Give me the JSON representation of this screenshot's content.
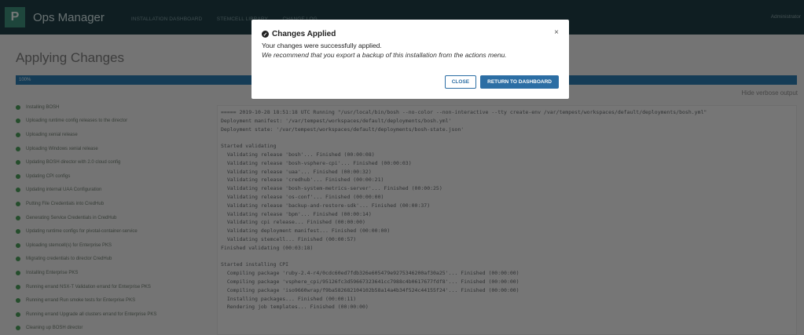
{
  "header": {
    "logo_letter": "P",
    "app_title": "Ops Manager",
    "nav": [
      "INSTALLATION DASHBOARD",
      "STEMCELL LIBRARY",
      "CHANGE LOG"
    ],
    "user": "Administrator"
  },
  "main": {
    "title": "Applying Changes",
    "progress": {
      "value_percent": 100,
      "label": "100%"
    },
    "hide_verbose": "Hide verbose output",
    "steps": [
      "Installing BOSH",
      "Uploading runtime config releases to the director",
      "Uploading xenial release",
      "Uploading Windows xenial release",
      "Updating BOSH director with 2.0 cloud config",
      "Updating CPI configs",
      "Updating internal UAA Configuration",
      "Putting File Credentials into CredHub",
      "Generating Service Credentials in CredHub",
      "Updating runtime configs for pivotal-container-service",
      "Uploading stemcell(s) for Enterprise PKS",
      "Migrating credentials to director CredHub",
      "Installing Enterprise PKS",
      "Running errand NSX-T Validation errand for Enterprise PKS",
      "Running errand Run smoke tests for Enterprise PKS",
      "Running errand Upgrade all clusters errand for Enterprise PKS",
      "Cleaning up BOSH director"
    ],
    "log_lines": [
      "===== 2019-10-28 18:51:18 UTC Running \"/usr/local/bin/bosh --no-color --non-interactive --tty create-env /var/tempest/workspaces/default/deployments/bosh.yml\"",
      "Deployment manifest: '/var/tempest/workspaces/default/deployments/bosh.yml'",
      "Deployment state: '/var/tempest/workspaces/default/deployments/bosh-state.json'",
      "",
      "Started validating",
      "  Validating release 'bosh'... Finished (00:00:08)",
      "  Validating release 'bosh-vsphere-cpi'... Finished (00:00:03)",
      "  Validating release 'uaa'... Finished (00:00:32)",
      "  Validating release 'credhub'... Finished (00:00:21)",
      "  Validating release 'bosh-system-metrics-server'... Finished (00:00:25)",
      "  Validating release 'os-conf'... Finished (00:00:00)",
      "  Validating release 'backup-and-restore-sdk'... Finished (00:00:37)",
      "  Validating release 'bpm'... Finished (00:00:14)",
      "  Validating cpi release... Finished (00:00:00)",
      "  Validating deployment manifest... Finished (00:00:00)",
      "  Validating stemcell... Finished (00:00:57)",
      "Finished validating (00:03:18)",
      "",
      "Started installing CPI",
      "  Compiling package 'ruby-2.4-r4/0cdc60ed7fdb326e605479e9275346200af30a25'... Finished (00:00:00)",
      "  Compiling package 'vsphere_cpi/95126fc3d59667323641cc7988c4b0617677fdf8'... Finished (00:00:00)",
      "  Compiling package 'iso9660wrap/f9ba582682104102b58a14a4b34f524c44155f24'... Finished (00:00:00)",
      "  Installing packages... Finished (00:00:11)",
      "  Rendering job templates... Finished (00:00:00)"
    ]
  },
  "modal": {
    "title": "Changes Applied",
    "message": "Your changes were successfully applied.",
    "note": "We recommend that you export a backup of this installation from the actions menu.",
    "close_label": "CLOSE",
    "return_label": "RETURN TO DASHBOARD",
    "close_icon_glyph": "×",
    "check_glyph": "✓"
  }
}
